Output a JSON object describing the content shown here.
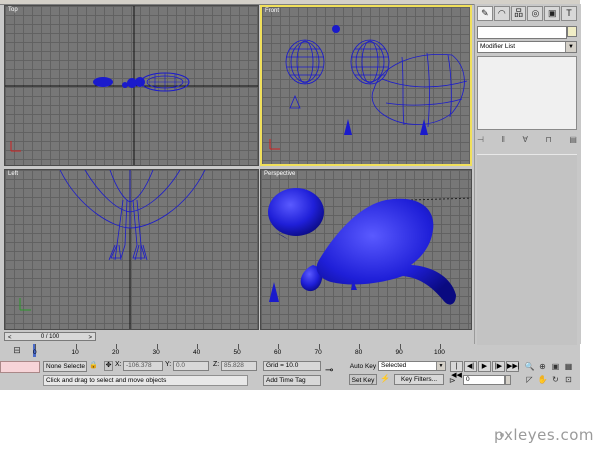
{
  "viewports": {
    "top": {
      "label": "Top"
    },
    "front": {
      "label": "Front"
    },
    "left": {
      "label": "Left"
    },
    "perspective": {
      "label": "Perspective"
    }
  },
  "command_panel": {
    "tabs": [
      {
        "icon": "create-icon",
        "glyph": "✎"
      },
      {
        "icon": "modify-icon",
        "glyph": "◠"
      },
      {
        "icon": "hierarchy-icon",
        "glyph": "品"
      },
      {
        "icon": "motion-icon",
        "glyph": "◎"
      },
      {
        "icon": "display-icon",
        "glyph": "▣"
      },
      {
        "icon": "utilities-icon",
        "glyph": "T"
      }
    ],
    "object_name": "",
    "object_color": "#f0edc6",
    "modifier_list": "Modifier List"
  },
  "time_slider": {
    "label": "0 / 100",
    "prev": "<",
    "next": ">"
  },
  "ruler": {
    "ticks": [
      "0",
      "10",
      "20",
      "30",
      "40",
      "50",
      "60",
      "70",
      "80",
      "90",
      "100"
    ]
  },
  "status_bar": {
    "selection": "None Selecte",
    "x_label": "X:",
    "x_value": "-106.378",
    "y_label": "Y:",
    "y_value": "0.0",
    "z_label": "Z:",
    "z_value": "85.828",
    "prompt": "Click and drag to select and move objects",
    "grid": "Grid = 10.0",
    "add_time_tag": "Add Time Tag",
    "auto_key": "Auto Key",
    "set_key": "Set Key",
    "selected_dropdown": "Selected",
    "key_filters": "Key Filters...",
    "frame": "0"
  },
  "playback": {
    "buttons": [
      "|◀◀",
      "◀|",
      "▶",
      "|▶",
      "▶▶|"
    ]
  },
  "colors": {
    "viewport_bg": "#777777",
    "active_border": "#f1e05b",
    "model": "#1a1acc",
    "ui_bg": "#c8c8c8"
  },
  "watermark": "pxleyes.com"
}
